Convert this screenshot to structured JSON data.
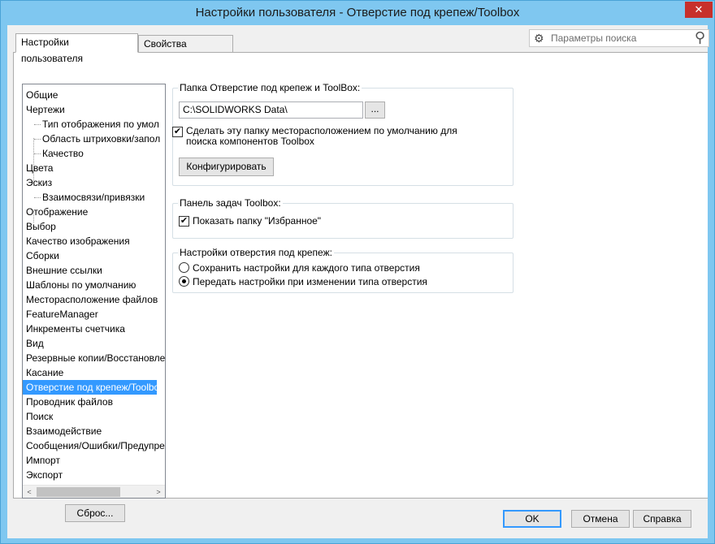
{
  "window": {
    "title": "Настройки пользователя - Отверстие под крепеж/Toolbox",
    "close_glyph": "✕"
  },
  "tabs": [
    {
      "label": "Настройки пользователя"
    },
    {
      "label": "Свойства документа"
    }
  ],
  "search": {
    "placeholder": "Параметры поиска"
  },
  "tree": {
    "items": [
      {
        "label": "Общие",
        "level": 0
      },
      {
        "label": "Чертежи",
        "level": 0
      },
      {
        "label": "Тип отображения по умол",
        "level": 1
      },
      {
        "label": "Область штриховки/запол",
        "level": 1
      },
      {
        "label": "Качество",
        "level": 1
      },
      {
        "label": "Цвета",
        "level": 0
      },
      {
        "label": "Эскиз",
        "level": 0
      },
      {
        "label": "Взаимосвязи/привязки",
        "level": 1
      },
      {
        "label": "Отображение",
        "level": 0
      },
      {
        "label": "Выбор",
        "level": 0
      },
      {
        "label": "Качество изображения",
        "level": 0
      },
      {
        "label": "Сборки",
        "level": 0
      },
      {
        "label": "Внешние ссылки",
        "level": 0
      },
      {
        "label": "Шаблоны по умолчанию",
        "level": 0
      },
      {
        "label": "Месторасположение файлов",
        "level": 0
      },
      {
        "label": "FeatureManager",
        "level": 0
      },
      {
        "label": "Инкременты счетчика",
        "level": 0
      },
      {
        "label": "Вид",
        "level": 0
      },
      {
        "label": "Резервные копии/Восстановление",
        "level": 0
      },
      {
        "label": "Касание",
        "level": 0
      },
      {
        "label": "Отверстие под крепеж/Toolbox",
        "level": 0,
        "selected": true
      },
      {
        "label": "Проводник файлов",
        "level": 0
      },
      {
        "label": "Поиск",
        "level": 0
      },
      {
        "label": "Взаимодействие",
        "level": 0
      },
      {
        "label": "Сообщения/Ошибки/Предупреждения",
        "level": 0
      },
      {
        "label": "Импорт",
        "level": 0
      },
      {
        "label": "Экспорт",
        "level": 0
      }
    ],
    "scroll_left": "<",
    "scroll_right": ">"
  },
  "reset_button": "Сброс...",
  "folder_group": {
    "title": "Папка Отверстие под крепеж и ToolBox:",
    "path_value": "C:\\SOLIDWORKS Data\\",
    "browse_label": "...",
    "default_checkbox_line1": "Сделать эту папку месторасположением по умолчанию для",
    "default_checkbox_line2": "поиска компонентов Toolbox",
    "default_checked": true,
    "configure_button": "Конфигурировать"
  },
  "taskpane_group": {
    "title": "Панель задач Toolbox:",
    "show_favorites_label": "Показать папку \"Избранное\"",
    "show_favorites_checked": true
  },
  "hole_group": {
    "title": "Настройки отверстия под крепеж:",
    "option1": "Сохранить настройки для каждого типа отверстия",
    "option2": "Передать настройки при изменении типа отверстия",
    "selected_option": 2
  },
  "buttons": {
    "ok": "OK",
    "cancel": "Отмена",
    "help": "Справка"
  },
  "colors": {
    "accent": "#3399ff",
    "frame": "#7fc7f0",
    "close": "#c7302b"
  },
  "icons": {
    "search": "search-icon",
    "gear": "gear-icon",
    "close": "close-icon"
  }
}
